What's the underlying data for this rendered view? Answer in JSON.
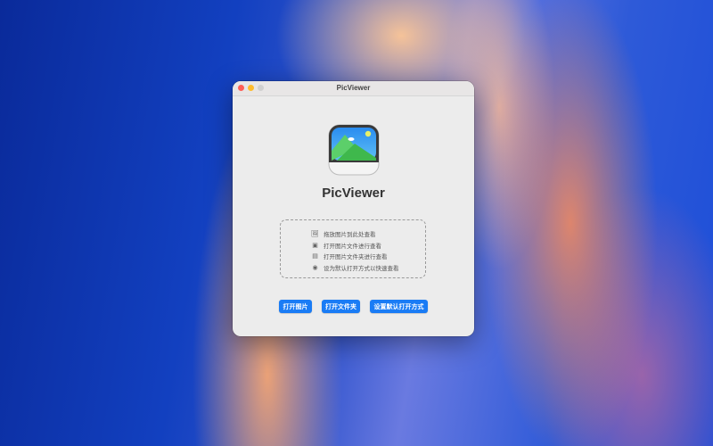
{
  "window": {
    "title": "PicViewer"
  },
  "app": {
    "name": "PicViewer"
  },
  "dropzone": {
    "hints": [
      {
        "icon": "photo-drop-icon",
        "label": "拖放图片到此处查看"
      },
      {
        "icon": "photo-stack-icon",
        "label": "打开图片文件进行查看"
      },
      {
        "icon": "folder-photo-icon",
        "label": "打开图片文件夹进行查看"
      },
      {
        "icon": "eye-icon",
        "label": "设为默认打开方式以快速查看"
      }
    ]
  },
  "buttons": {
    "open_image": "打开图片",
    "open_folder": "打开文件夹",
    "set_default": "设置默认打开方式"
  },
  "colors": {
    "accent": "#1a7cf5",
    "close": "#fe5f57",
    "minimize": "#febc2e",
    "zoom": "#d0d0d0"
  }
}
